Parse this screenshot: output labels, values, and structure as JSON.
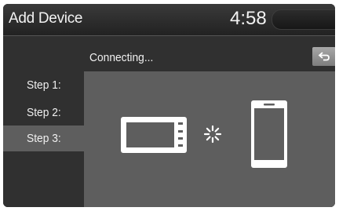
{
  "header": {
    "title": "Add Device",
    "clock": "4:58"
  },
  "status": {
    "text": "Connecting..."
  },
  "steps": [
    {
      "label": "Step 1:"
    },
    {
      "label": "Step 2:"
    },
    {
      "label": "Step 3:",
      "active": true
    }
  ],
  "icons": {
    "back": "back-arrow-icon",
    "head_unit": "head-unit-icon",
    "connecting": "loading-spinner-icon",
    "phone": "smartphone-icon"
  },
  "colors": {
    "background": "#1a1a1a",
    "panel": "#5e5e5e",
    "highlight": "#5e5e5e",
    "text": "#f0f0f0"
  }
}
